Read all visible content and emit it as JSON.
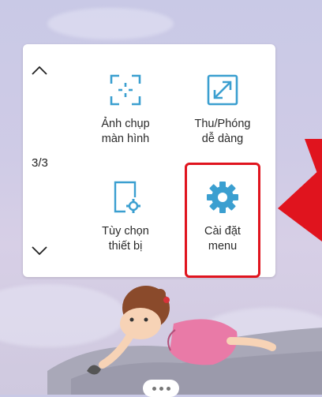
{
  "menu": {
    "page_indicator": "3/3",
    "nav_up_icon": "chevron-up-icon",
    "nav_down_icon": "chevron-down-icon",
    "accent_color": "#3b9fd0",
    "items": [
      {
        "label": "Ảnh chụp\nmàn hình",
        "icon": "screenshot-icon"
      },
      {
        "label": "Thu/Phóng\ndễ dàng",
        "icon": "zoom-icon"
      },
      {
        "label": "Tùy chọn\nthiết bị",
        "icon": "device-options-icon"
      },
      {
        "label": "Cài đặt\nmenu",
        "icon": "settings-gear-icon"
      }
    ]
  },
  "annotation": {
    "highlight_color": "#e0141e"
  },
  "bottom_bar": {
    "more_icon": "more-dots-icon"
  }
}
